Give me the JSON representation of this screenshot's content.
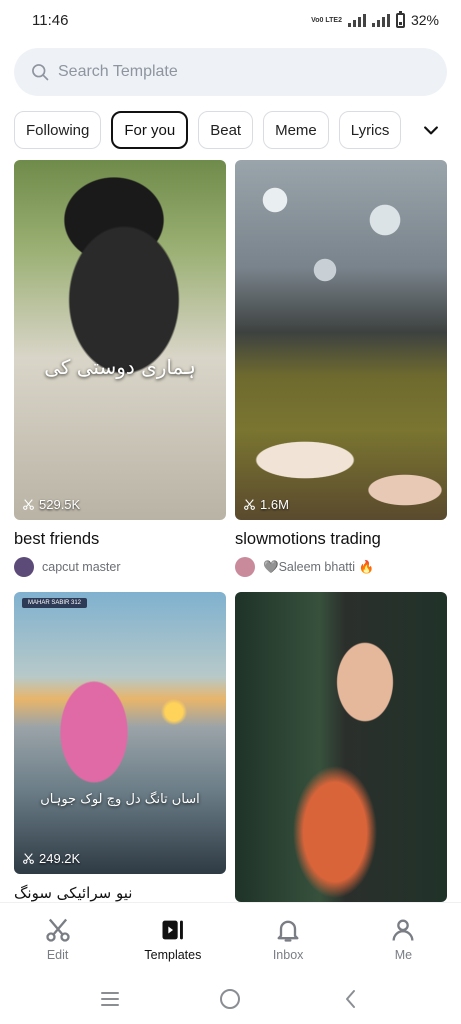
{
  "status_bar": {
    "time": "11:46",
    "network_label": "Vo0 LTE2",
    "battery": "32%"
  },
  "search": {
    "placeholder": "Search Template"
  },
  "categories": [
    {
      "label": "Following",
      "active": false
    },
    {
      "label": "For you",
      "active": true
    },
    {
      "label": "Beat",
      "active": false
    },
    {
      "label": "Meme",
      "active": false
    },
    {
      "label": "Lyrics",
      "active": false
    }
  ],
  "templates": [
    {
      "title": "best friends",
      "uses": "529.5K",
      "author": "capcut master",
      "overlay_text": "ہماری دوستی کی",
      "avatar_color": "#5c4a78"
    },
    {
      "title": "slowmotions trading",
      "uses": "1.6M",
      "author": "🩶Saleem bhatti 🔥",
      "avatar_color": "#c98a9c"
    },
    {
      "title": "نیو سرائیکی سونگ",
      "uses": "249.2K",
      "banner_text": "MAHAR SABIR 312",
      "overlay_text": "اساں تانگ دل وچ لوک جوہاں"
    },
    {
      "title": "",
      "uses": ""
    }
  ],
  "bottom_nav": [
    {
      "label": "Edit",
      "icon": "scissors-icon",
      "active": false
    },
    {
      "label": "Templates",
      "icon": "templates-icon",
      "active": true
    },
    {
      "label": "Inbox",
      "icon": "bell-icon",
      "active": false
    },
    {
      "label": "Me",
      "icon": "person-icon",
      "active": false
    }
  ],
  "colors": {
    "accent": "#111111",
    "muted": "#7a7e84",
    "search_bg": "#eef2f7"
  }
}
